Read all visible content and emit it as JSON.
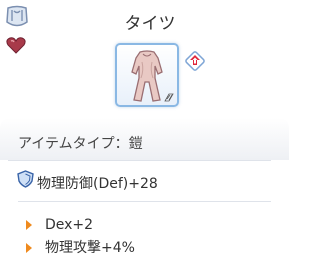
{
  "item": {
    "name": "タイツ",
    "type_label": "アイテムタイプ：鎧",
    "defense": "物理防御(Def)+28",
    "bonuses": [
      "Dex+2",
      "物理攻撃+4%"
    ]
  },
  "icons": {
    "top_left": [
      "armor-icon",
      "heart-icon"
    ],
    "item": "tights-icon",
    "compare": "equip-up-arrow-icon",
    "stat_bullet": "orange-triangle-icon"
  },
  "colors": {
    "slot_border": "#8ab8e4",
    "compare_arrow": "#e0263a",
    "bullet": "#ef8a1e"
  }
}
